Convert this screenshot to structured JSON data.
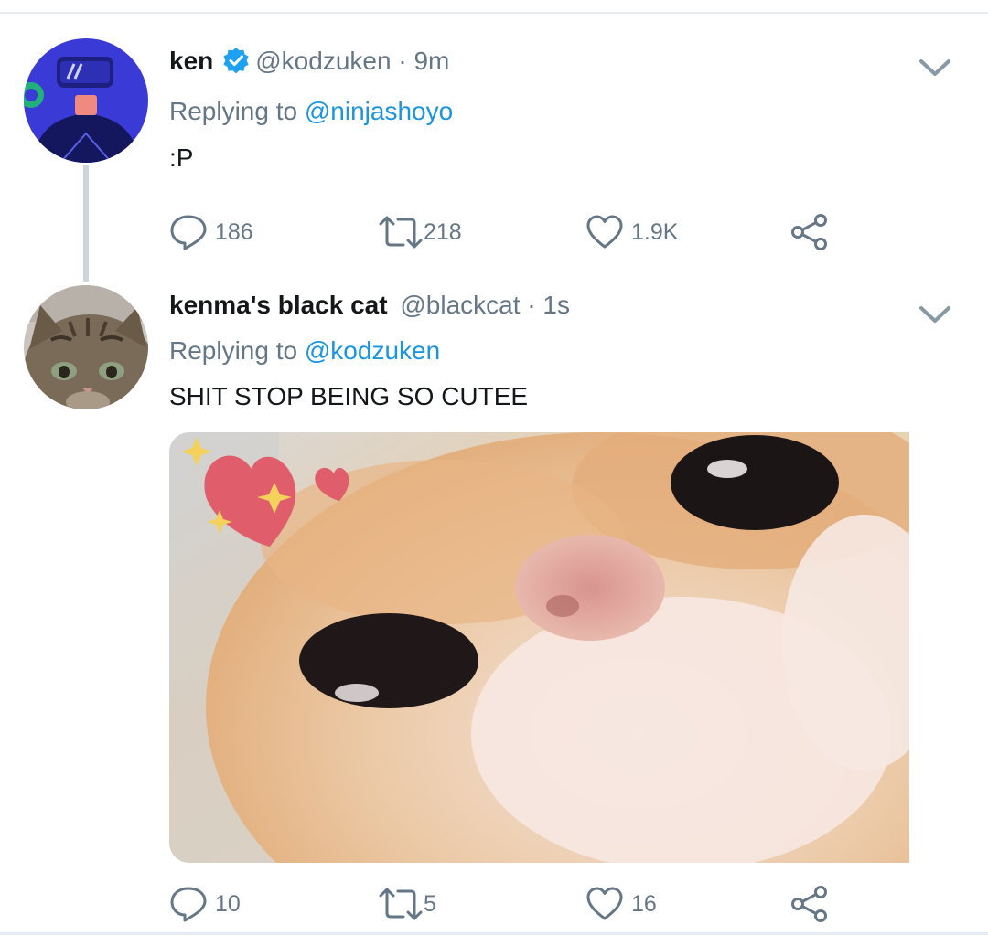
{
  "tweets": [
    {
      "name": "ken",
      "verified": true,
      "handle": "@kodzuken",
      "time": "9m",
      "replying_prefix": "Replying to",
      "replying_to": "@ninjashoyo",
      "text": ":P",
      "replies": "186",
      "retweets": "218",
      "likes": "1.9K",
      "avatar": "vr-headset-character-avatar"
    },
    {
      "name": "kenma's black cat",
      "verified": false,
      "handle": "@blackcat",
      "time": "1s",
      "replying_prefix": "Replying to",
      "replying_to": "@kodzuken",
      "text": "SHIT STOP BEING SO CUTEE",
      "replies": "10",
      "retweets": "5",
      "likes": "16",
      "avatar": "tabby-cat-photo-avatar",
      "media": "close-up-orange-cat-photo-with-hearts-and-sparkles"
    }
  ],
  "colors": {
    "link": "#1b95e0",
    "muted": "#657786",
    "verified": "#1da1f2",
    "divider": "#e6ecf0"
  },
  "icons": [
    "reply-icon",
    "retweet-icon",
    "like-icon",
    "share-icon",
    "caret-down-icon",
    "verified-badge-icon"
  ]
}
